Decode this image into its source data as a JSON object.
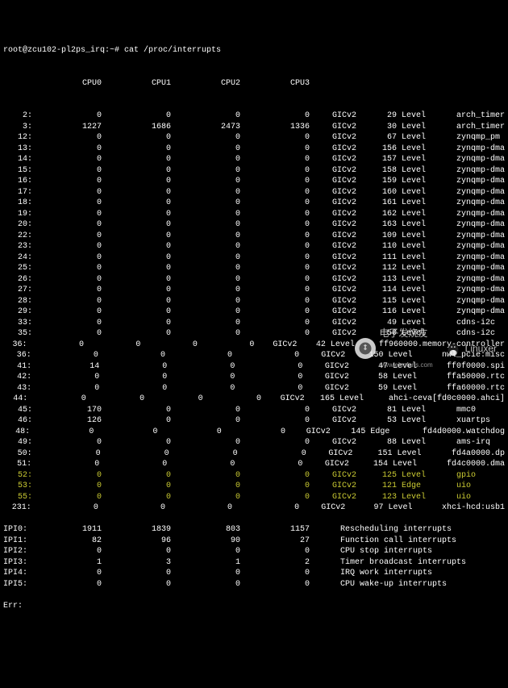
{
  "prompt": "root@zcu102-pl2ps_irq:~# cat /proc/interrupts",
  "headers": [
    "CPU0",
    "CPU1",
    "CPU2",
    "CPU3"
  ],
  "rows": [
    {
      "irq": "2",
      "c": [
        "0",
        "0",
        "0",
        "0"
      ],
      "chip": "GICv2",
      "n": "29",
      "t": "Level",
      "name": "arch_timer",
      "hi": false
    },
    {
      "irq": "3",
      "c": [
        "1227",
        "1686",
        "2473",
        "1336"
      ],
      "chip": "GICv2",
      "n": "30",
      "t": "Level",
      "name": "arch_timer",
      "hi": false
    },
    {
      "irq": "12",
      "c": [
        "0",
        "0",
        "0",
        "0"
      ],
      "chip": "GICv2",
      "n": "67",
      "t": "Level",
      "name": "zynqmp_pm",
      "hi": false
    },
    {
      "irq": "13",
      "c": [
        "0",
        "0",
        "0",
        "0"
      ],
      "chip": "GICv2",
      "n": "156",
      "t": "Level",
      "name": "zynqmp-dma",
      "hi": false
    },
    {
      "irq": "14",
      "c": [
        "0",
        "0",
        "0",
        "0"
      ],
      "chip": "GICv2",
      "n": "157",
      "t": "Level",
      "name": "zynqmp-dma",
      "hi": false
    },
    {
      "irq": "15",
      "c": [
        "0",
        "0",
        "0",
        "0"
      ],
      "chip": "GICv2",
      "n": "158",
      "t": "Level",
      "name": "zynqmp-dma",
      "hi": false
    },
    {
      "irq": "16",
      "c": [
        "0",
        "0",
        "0",
        "0"
      ],
      "chip": "GICv2",
      "n": "159",
      "t": "Level",
      "name": "zynqmp-dma",
      "hi": false
    },
    {
      "irq": "17",
      "c": [
        "0",
        "0",
        "0",
        "0"
      ],
      "chip": "GICv2",
      "n": "160",
      "t": "Level",
      "name": "zynqmp-dma",
      "hi": false
    },
    {
      "irq": "18",
      "c": [
        "0",
        "0",
        "0",
        "0"
      ],
      "chip": "GICv2",
      "n": "161",
      "t": "Level",
      "name": "zynqmp-dma",
      "hi": false
    },
    {
      "irq": "19",
      "c": [
        "0",
        "0",
        "0",
        "0"
      ],
      "chip": "GICv2",
      "n": "162",
      "t": "Level",
      "name": "zynqmp-dma",
      "hi": false
    },
    {
      "irq": "20",
      "c": [
        "0",
        "0",
        "0",
        "0"
      ],
      "chip": "GICv2",
      "n": "163",
      "t": "Level",
      "name": "zynqmp-dma",
      "hi": false
    },
    {
      "irq": "22",
      "c": [
        "0",
        "0",
        "0",
        "0"
      ],
      "chip": "GICv2",
      "n": "109",
      "t": "Level",
      "name": "zynqmp-dma",
      "hi": false
    },
    {
      "irq": "23",
      "c": [
        "0",
        "0",
        "0",
        "0"
      ],
      "chip": "GICv2",
      "n": "110",
      "t": "Level",
      "name": "zynqmp-dma",
      "hi": false
    },
    {
      "irq": "24",
      "c": [
        "0",
        "0",
        "0",
        "0"
      ],
      "chip": "GICv2",
      "n": "111",
      "t": "Level",
      "name": "zynqmp-dma",
      "hi": false
    },
    {
      "irq": "25",
      "c": [
        "0",
        "0",
        "0",
        "0"
      ],
      "chip": "GICv2",
      "n": "112",
      "t": "Level",
      "name": "zynqmp-dma",
      "hi": false
    },
    {
      "irq": "26",
      "c": [
        "0",
        "0",
        "0",
        "0"
      ],
      "chip": "GICv2",
      "n": "113",
      "t": "Level",
      "name": "zynqmp-dma",
      "hi": false
    },
    {
      "irq": "27",
      "c": [
        "0",
        "0",
        "0",
        "0"
      ],
      "chip": "GICv2",
      "n": "114",
      "t": "Level",
      "name": "zynqmp-dma",
      "hi": false
    },
    {
      "irq": "28",
      "c": [
        "0",
        "0",
        "0",
        "0"
      ],
      "chip": "GICv2",
      "n": "115",
      "t": "Level",
      "name": "zynqmp-dma",
      "hi": false
    },
    {
      "irq": "29",
      "c": [
        "0",
        "0",
        "0",
        "0"
      ],
      "chip": "GICv2",
      "n": "116",
      "t": "Level",
      "name": "zynqmp-dma",
      "hi": false
    },
    {
      "irq": "33",
      "c": [
        "0",
        "0",
        "0",
        "0"
      ],
      "chip": "GICv2",
      "n": "49",
      "t": "Level",
      "name": "cdns-i2c",
      "hi": false
    },
    {
      "irq": "35",
      "c": [
        "0",
        "0",
        "0",
        "0"
      ],
      "chip": "GICv2",
      "n": "50",
      "t": "Level",
      "name": "cdns-i2c",
      "hi": false
    },
    {
      "irq": "36",
      "c": [
        "0",
        "0",
        "0",
        "0"
      ],
      "chip": "GICv2",
      "n": "42",
      "t": "Level",
      "name": "ff960000.memory-controller",
      "hi": false
    },
    {
      "irq": "36",
      "c": [
        "0",
        "0",
        "0",
        "0"
      ],
      "chip": "GICv2",
      "n": "150",
      "t": "Level",
      "name": "nwl_pcie:misc",
      "hi": false
    },
    {
      "irq": "41",
      "c": [
        "14",
        "0",
        "0",
        "0"
      ],
      "chip": "GICv2",
      "n": "47",
      "t": "Level",
      "name": "ff0f0000.spi",
      "hi": false
    },
    {
      "irq": "42",
      "c": [
        "0",
        "0",
        "0",
        "0"
      ],
      "chip": "GICv2",
      "n": "58",
      "t": "Level",
      "name": "ffa50000.rtc",
      "hi": false
    },
    {
      "irq": "43",
      "c": [
        "0",
        "0",
        "0",
        "0"
      ],
      "chip": "GICv2",
      "n": "59",
      "t": "Level",
      "name": "ffa60000.rtc",
      "hi": false
    },
    {
      "irq": "44",
      "c": [
        "0",
        "0",
        "0",
        "0"
      ],
      "chip": "GICv2",
      "n": "165",
      "t": "Level",
      "name": "ahci-ceva[fd0c0000.ahci]",
      "hi": false
    },
    {
      "irq": "45",
      "c": [
        "170",
        "0",
        "0",
        "0"
      ],
      "chip": "GICv2",
      "n": "81",
      "t": "Level",
      "name": "mmc0",
      "hi": false
    },
    {
      "irq": "46",
      "c": [
        "126",
        "0",
        "0",
        "0"
      ],
      "chip": "GICv2",
      "n": "53",
      "t": "Level",
      "name": "xuartps",
      "hi": false
    },
    {
      "irq": "48",
      "c": [
        "0",
        "0",
        "0",
        "0"
      ],
      "chip": "GICv2",
      "n": "145",
      "t": "Edge",
      "name": "fd4d0000.watchdog",
      "hi": false
    },
    {
      "irq": "49",
      "c": [
        "0",
        "0",
        "0",
        "0"
      ],
      "chip": "GICv2",
      "n": "88",
      "t": "Level",
      "name": "ams-irq",
      "hi": false
    },
    {
      "irq": "50",
      "c": [
        "0",
        "0",
        "0",
        "0"
      ],
      "chip": "GICv2",
      "n": "151",
      "t": "Level",
      "name": "fd4a0000.dp",
      "hi": false
    },
    {
      "irq": "51",
      "c": [
        "0",
        "0",
        "0",
        "0"
      ],
      "chip": "GICv2",
      "n": "154",
      "t": "Level",
      "name": "fd4c0000.dma",
      "hi": false
    },
    {
      "irq": "52",
      "c": [
        "0",
        "0",
        "0",
        "0"
      ],
      "chip": "GICv2",
      "n": "125",
      "t": "Level",
      "name": "gpio",
      "hi": true
    },
    {
      "irq": "53",
      "c": [
        "0",
        "0",
        "0",
        "0"
      ],
      "chip": "GICv2",
      "n": "121",
      "t": "Edge",
      "name": "uio",
      "hi": true
    },
    {
      "irq": "55",
      "c": [
        "0",
        "0",
        "0",
        "0"
      ],
      "chip": "GICv2",
      "n": "123",
      "t": "Level",
      "name": "uio",
      "hi": true
    },
    {
      "irq": "231",
      "c": [
        "0",
        "0",
        "0",
        "0"
      ],
      "chip": "GICv2",
      "n": "97",
      "t": "Level",
      "name": "xhci-hcd:usb1",
      "hi": false
    }
  ],
  "ipi": [
    {
      "label": "IPI0",
      "c": [
        "1911",
        "1839",
        "803",
        "1157"
      ],
      "desc": "Rescheduling interrupts"
    },
    {
      "label": "IPI1",
      "c": [
        "82",
        "96",
        "90",
        "27"
      ],
      "desc": "Function call interrupts"
    },
    {
      "label": "IPI2",
      "c": [
        "0",
        "0",
        "0",
        "0"
      ],
      "desc": "CPU stop interrupts"
    },
    {
      "label": "IPI3",
      "c": [
        "1",
        "3",
        "1",
        "2"
      ],
      "desc": "Timer broadcast interrupts"
    },
    {
      "label": "IPI4",
      "c": [
        "0",
        "0",
        "0",
        "0"
      ],
      "desc": "IRQ work interrupts"
    },
    {
      "label": "IPI5",
      "c": [
        "0",
        "0",
        "0",
        "0"
      ],
      "desc": "CPU wake-up interrupts"
    }
  ],
  "err_label": "Err:",
  "watermark": {
    "text": "电子发烧友",
    "sub": "www.elecfans.com",
    "linuxer": "Linuxer"
  }
}
